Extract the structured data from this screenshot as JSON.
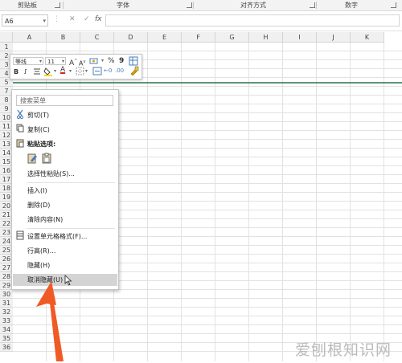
{
  "ribbon": {
    "groups": [
      "剪贴板",
      "字体",
      "对齐方式",
      "数字"
    ]
  },
  "formula_bar": {
    "name_box": "A6",
    "cancel_glyph": "✕",
    "enter_glyph": "✓",
    "fx_label": "fx",
    "formula": ""
  },
  "grid": {
    "columns": [
      "A",
      "B",
      "C",
      "D",
      "E",
      "F",
      "G",
      "H",
      "I",
      "J",
      "K"
    ],
    "rows": [
      "1",
      "2",
      "3",
      "4",
      "5",
      "7",
      "8",
      "9",
      "10",
      "11",
      "12",
      "13",
      "14",
      "15",
      "16",
      "17",
      "18",
      "19",
      "20",
      "21",
      "22",
      "23",
      "24",
      "25",
      "26",
      "27",
      "28",
      "29",
      "30",
      "31",
      "32",
      "33",
      "34",
      "35",
      "36"
    ],
    "selected_cell": "A6",
    "accent": "#217346"
  },
  "mini_toolbar": {
    "font_name": "等线",
    "font_size": "11",
    "grow_font": "A",
    "shrink_font": "A",
    "percent": "%",
    "comma": "9",
    "bold": "B",
    "italic": "I",
    "font_color_letter": "A"
  },
  "context_menu": {
    "search_placeholder": "搜索菜单",
    "items": [
      {
        "label": "剪切(T)",
        "icon": "scissors-icon"
      },
      {
        "label": "复制(C)",
        "icon": "copy-icon"
      },
      {
        "label": "粘贴选项:",
        "icon": "paste-icon"
      },
      {
        "label": "选择性粘贴(S)...",
        "icon": ""
      },
      {
        "label": "插入(I)",
        "icon": ""
      },
      {
        "label": "删除(D)",
        "icon": ""
      },
      {
        "label": "清除内容(N)",
        "icon": ""
      },
      {
        "label": "设置单元格格式(F)...",
        "icon": "format-cells-icon"
      },
      {
        "label": "行高(R)...",
        "icon": ""
      },
      {
        "label": "隐藏(H)",
        "icon": ""
      },
      {
        "label": "取消隐藏(U)",
        "icon": "",
        "highlighted": true
      }
    ]
  },
  "annotation": {
    "arrow_color": "#f05a24"
  },
  "watermark": {
    "text": "爱刨根知识网"
  }
}
